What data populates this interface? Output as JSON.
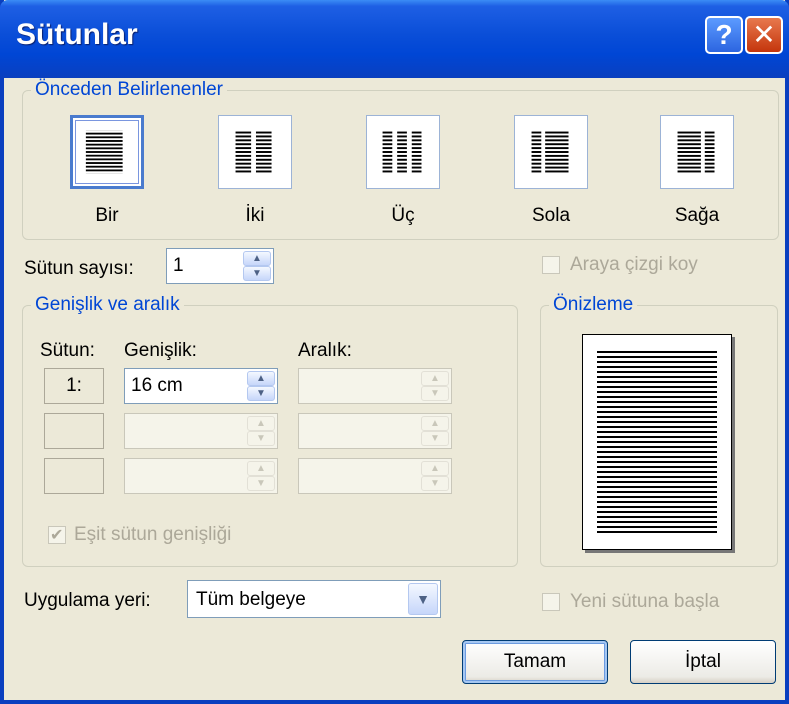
{
  "window": {
    "title": "Sütunlar",
    "help_glyph": "?",
    "close_glyph": "✕"
  },
  "presets": {
    "group_label": "Önceden Belirlenenler",
    "items": [
      {
        "label": "Bir",
        "icon": "one-column-icon"
      },
      {
        "label": "İki",
        "icon": "two-columns-icon"
      },
      {
        "label": "Üç",
        "icon": "three-columns-icon"
      },
      {
        "label": "Sola",
        "icon": "left-column-icon"
      },
      {
        "label": "Sağa",
        "icon": "right-column-icon"
      }
    ],
    "selected": "Bir"
  },
  "column_count": {
    "label": "Sütun sayısı:",
    "value": "1"
  },
  "line_between": {
    "label": "Araya çizgi koy",
    "checked": false
  },
  "width_spacing": {
    "group_label": "Genişlik ve aralık",
    "headers": {
      "column": "Sütun:",
      "width": "Genişlik:",
      "spacing": "Aralık:"
    },
    "rows": [
      {
        "index": "1:",
        "width": "16 cm",
        "spacing": ""
      },
      {
        "index": "",
        "width": "",
        "spacing": ""
      },
      {
        "index": "",
        "width": "",
        "spacing": ""
      }
    ],
    "equal_width": {
      "label": "Eşit sütun genişliği",
      "checked": true
    }
  },
  "preview": {
    "group_label": "Önizleme"
  },
  "apply_to": {
    "label": "Uygulama yeri:",
    "value": "Tüm belgeye"
  },
  "new_column": {
    "label": "Yeni sütuna başla",
    "checked": false
  },
  "buttons": {
    "ok": "Tamam",
    "cancel": "İptal"
  }
}
